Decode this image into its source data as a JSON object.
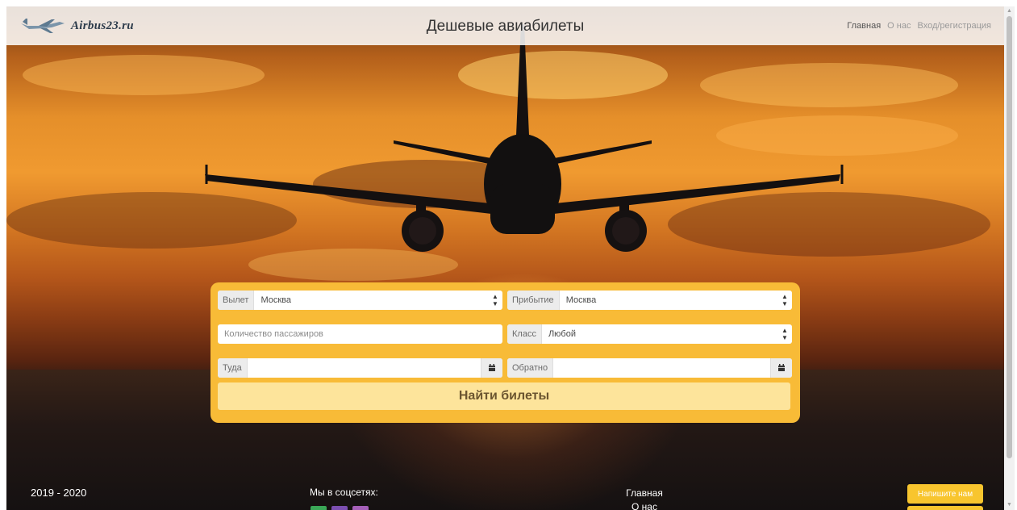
{
  "navbar": {
    "brand_name": "Airbus23.ru",
    "site_title": "Дешевые авиабилеты",
    "links": [
      {
        "label": "Главная",
        "active": true
      },
      {
        "label": "О нас",
        "active": false
      },
      {
        "label": "Вход/регистрация",
        "active": false
      }
    ]
  },
  "search_form": {
    "departure": {
      "label": "Вылет",
      "value": "Москва"
    },
    "arrival": {
      "label": "Прибытие",
      "value": "Москва"
    },
    "passengers": {
      "placeholder": "Количество пассажиров"
    },
    "travel_class": {
      "label": "Класс",
      "value": "Любой"
    },
    "date_there": {
      "label": "Туда",
      "value": ""
    },
    "date_back": {
      "label": "Обратно",
      "value": ""
    },
    "submit_label": "Найти билеты"
  },
  "footer": {
    "years": "2019 - 2020",
    "social_title": "Мы в соцсетях:",
    "social_icons": [
      {
        "name": "green-social-icon",
        "color": "#3aa757"
      },
      {
        "name": "purple-social-icon",
        "color": "#7b4fb0"
      },
      {
        "name": "pink-social-icon",
        "color": "#a560b8"
      }
    ],
    "links": [
      "Главная",
      "О нас"
    ],
    "contact_button": "Напишите нам"
  },
  "colors": {
    "form_background": "#f8bb37",
    "search_button": "#fde49b",
    "contact_button": "#f8c52e"
  }
}
